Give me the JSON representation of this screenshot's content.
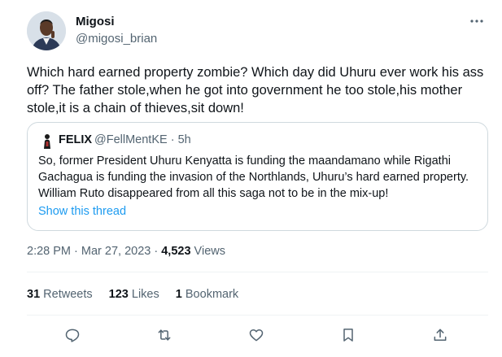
{
  "author": {
    "name": "Migosi",
    "handle": "@migosi_brian"
  },
  "more_icon": "more-horizontal-icon",
  "tweet_text": "Which hard earned property zombie? Which day did Uhuru ever work his ass off? The father stole,when he got into government he too stole,his mother stole,it is a chain of thieves,sit down!",
  "quoted": {
    "name": "FELIX",
    "handle": "@FellMentKE",
    "separator": " · ",
    "time": "5h",
    "text": "So, former President Uhuru Kenyatta is funding the maandamano while Rigathi Gachagua is funding the invasion of the Northlands, Uhuru’s hard earned property. William Ruto disappeared from all this saga not to be in the mix-up!",
    "show_thread": "Show this thread"
  },
  "meta": {
    "time": "2:28 PM",
    "dot1": " · ",
    "date": "Mar 27, 2023",
    "dot2": " · ",
    "views_count": "4,523",
    "views_label": " Views"
  },
  "stats": {
    "retweets_count": "31",
    "retweets_label": " Retweets",
    "likes_count": "123",
    "likes_label": " Likes",
    "bookmarks_count": "1",
    "bookmarks_label": " Bookmark"
  },
  "actions": [
    "reply-icon",
    "retweet-icon",
    "like-icon",
    "bookmark-icon",
    "share-icon"
  ],
  "colors": {
    "text": "#0f1419",
    "secondary": "#536471",
    "link": "#1d9bf0",
    "border": "#cfd9de"
  }
}
